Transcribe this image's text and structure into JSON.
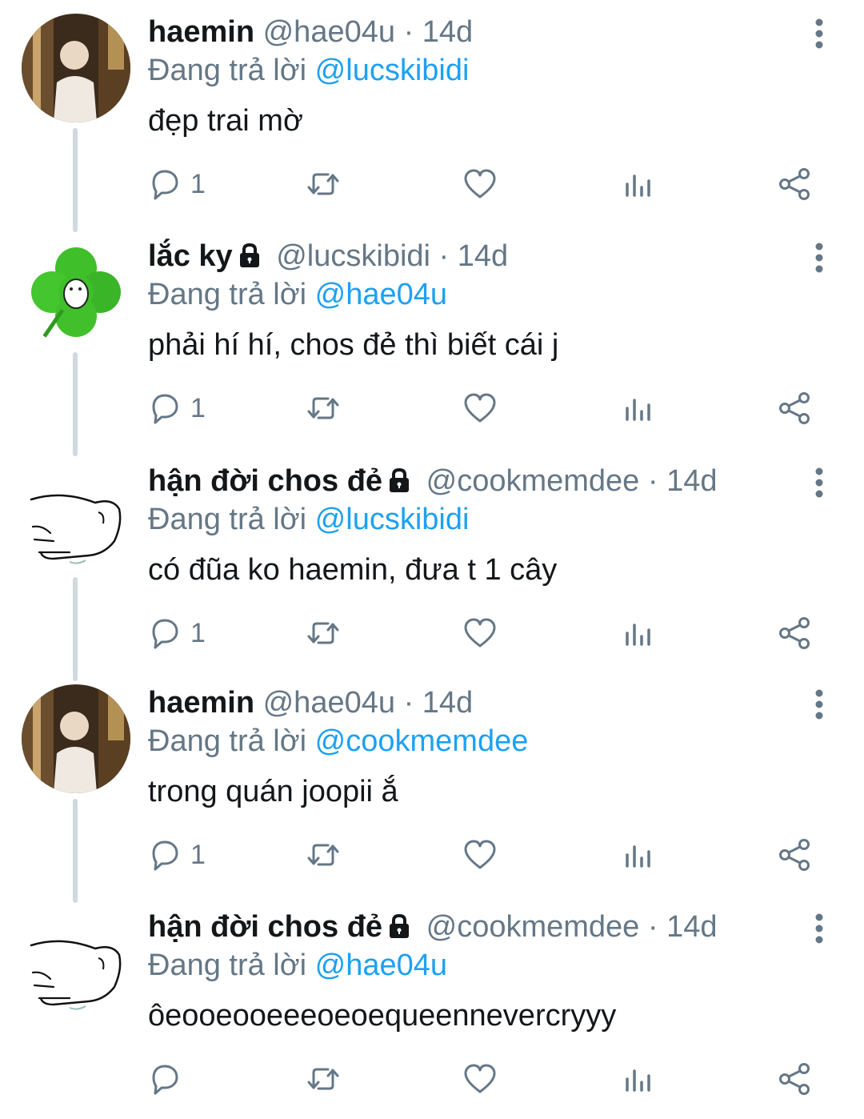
{
  "colors": {
    "link": "#1da1f2",
    "muted": "#657786",
    "text": "#14171a",
    "thread_line": "#cfd9de"
  },
  "reply_prefix": "Đang trả lời",
  "tweets": [
    {
      "name": "haemin",
      "handle": "@hae04u",
      "time": "· 14d",
      "locked": false,
      "avatar": "photo-avatar",
      "reply_to": "@lucskibidi",
      "text": "đẹp trai mờ",
      "reply_count": "1"
    },
    {
      "name": "lắc ky",
      "handle": "@lucskibidi",
      "time": "· 14d",
      "locked": true,
      "avatar": "clover-avatar",
      "reply_to": "@hae04u",
      "text": "phải hí hí, chos đẻ thì biết cái j",
      "reply_count": "1"
    },
    {
      "name": "hận đời chos đẻ",
      "handle": "@cookmemdee",
      "time": "· 14d",
      "locked": true,
      "avatar": "sketch-avatar",
      "reply_to": "@lucskibidi",
      "text": "có đũa ko haemin, đưa t 1 cây",
      "reply_count": "1"
    },
    {
      "name": "haemin",
      "handle": "@hae04u",
      "time": "· 14d",
      "locked": false,
      "avatar": "photo-avatar",
      "reply_to": "@cookmemdee",
      "text": "trong quán joopii ắ",
      "reply_count": "1"
    },
    {
      "name": "hận đời chos đẻ",
      "handle": "@cookmemdee",
      "time": "· 14d",
      "locked": true,
      "avatar": "sketch-avatar",
      "reply_to": "@hae04u",
      "text": "ôeooeooeeeoeoequeennevercryyy",
      "reply_count": ""
    }
  ]
}
